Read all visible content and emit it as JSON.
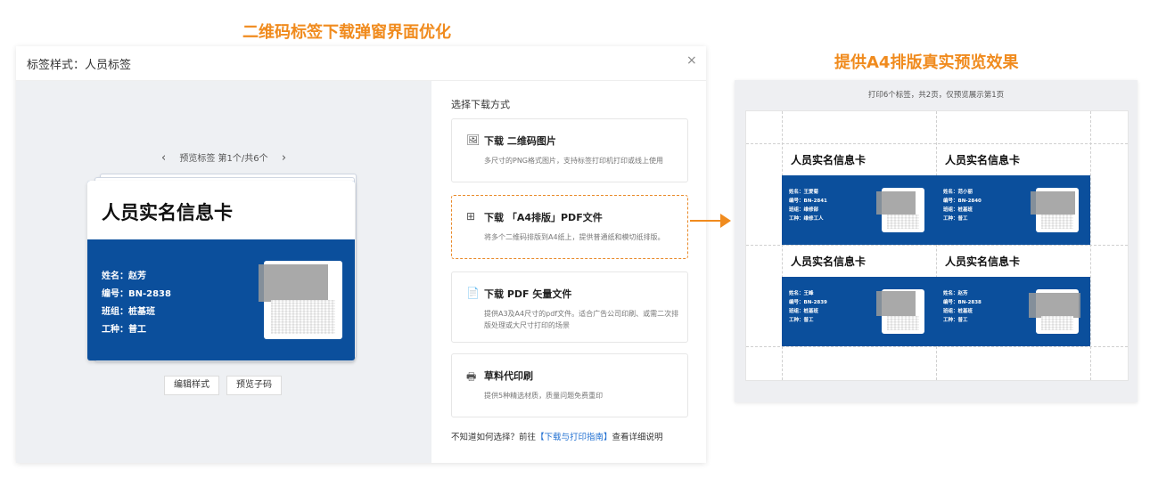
{
  "headings": {
    "left": "二维码标签下载弹窗界面优化",
    "right": "提供A4排版真实预览效果"
  },
  "dialog": {
    "title": "标签样式：人员标签",
    "close": "×",
    "pager": {
      "prev": "‹",
      "text": "预览标签 第1个/共6个",
      "next": "›"
    },
    "card": {
      "title": "人员实名信息卡",
      "fields": [
        "姓名：赵芳",
        "编号：BN-2838",
        "班组：桩基班",
        "工种：普工"
      ]
    },
    "buttons": {
      "edit": "编辑样式",
      "preview": "预览子码"
    },
    "choose_label": "选择下载方式",
    "options": [
      {
        "icon": "image-icon",
        "glyph": "🖼",
        "title": "下载 二维码图片",
        "desc": "多尺寸的PNG格式图片，支持标签打印机打印或线上使用"
      },
      {
        "icon": "grid-icon",
        "glyph": "⊞",
        "title": "下载 「A4排版」PDF文件",
        "desc": "将多个二维码排版到A4纸上，提供普通纸和模切纸排版。"
      },
      {
        "icon": "pdf-icon",
        "glyph": "📄",
        "title": "下载 PDF 矢量文件",
        "desc": "提供A3及A4尺寸的pdf文件。适合广告公司印刷、或需二次排版处理或大尺寸打印的场景"
      },
      {
        "icon": "printer-icon",
        "glyph": "🖶",
        "title": "草料代印刷",
        "desc": "提供5种精选材质，质量问题免费重印"
      }
    ],
    "guide": {
      "prefix": "不知道如何选择？前往",
      "link": "【下载与打印指南】",
      "suffix": "查看详细说明"
    }
  },
  "preview": {
    "note": "打印6个标签，共2页，仅预览展示第1页",
    "cards": [
      {
        "title": "人员实名信息卡",
        "fields": [
          "姓名：王爱菊",
          "编号：BN-2841",
          "班组：维修部",
          "工种：维修工人"
        ]
      },
      {
        "title": "人员实名信息卡",
        "fields": [
          "姓名：范小丽",
          "编号：BN-2840",
          "班组：桩基班",
          "工种：普工"
        ]
      },
      {
        "title": "人员实名信息卡",
        "fields": [
          "姓名：王峰",
          "编号：BN-2839",
          "班组：桩基班",
          "工种：普工"
        ]
      },
      {
        "title": "人员实名信息卡",
        "fields": [
          "姓名：赵芳",
          "编号：BN-2838",
          "班组：桩基班",
          "工种：普工"
        ]
      }
    ]
  },
  "colors": {
    "accent": "#f08b1e",
    "card_blue": "#0b4f9c",
    "link": "#1f6fd1"
  }
}
